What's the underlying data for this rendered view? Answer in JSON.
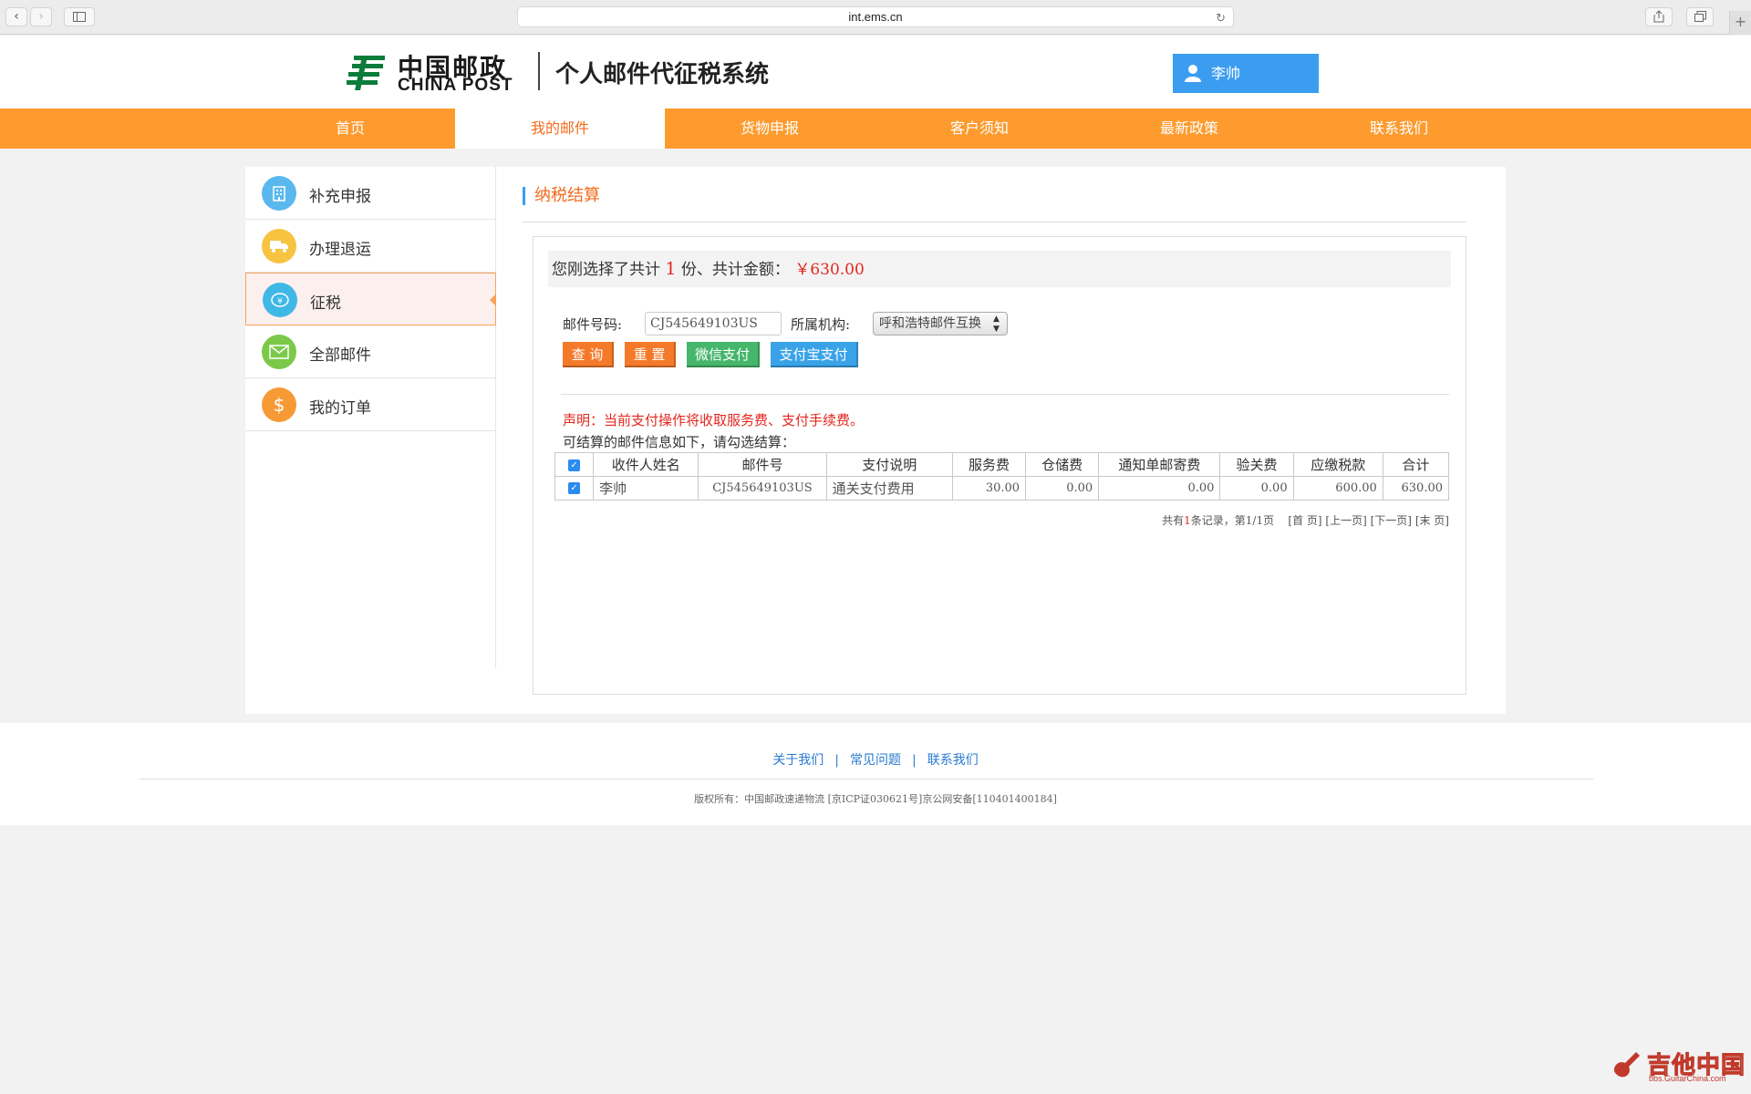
{
  "browser": {
    "url": "int.ems.cn",
    "plus": "+"
  },
  "header": {
    "logo_cn": "中国邮政",
    "logo_en": "CHINA POST",
    "system_title": "个人邮件代征税系统",
    "user_name": "李帅"
  },
  "nav": {
    "items": [
      "首页",
      "我的邮件",
      "货物申报",
      "客户须知",
      "最新政策",
      "联系我们"
    ],
    "active": "我的邮件"
  },
  "sidebar": {
    "items": [
      {
        "label": "补充申报",
        "icon": "building-icon",
        "color": "#5bb8ef"
      },
      {
        "label": "办理退运",
        "icon": "truck-icon",
        "color": "#f7c340"
      },
      {
        "label": "征税",
        "icon": "tax-icon",
        "color": "#3fb8e6"
      },
      {
        "label": "全部邮件",
        "icon": "mail-icon",
        "color": "#7cc94a"
      },
      {
        "label": "我的订单",
        "icon": "dollar-icon",
        "color": "#f69a35"
      }
    ],
    "active": "征税"
  },
  "content": {
    "section_title": "纳税结算",
    "summary_prefix": "您刚选择了共计",
    "summary_count": "1",
    "summary_mid": "份、共计金额：",
    "summary_amount": "￥630.00",
    "form": {
      "mail_no_label": "邮件号码:",
      "mail_no_value": "CJ545649103US",
      "org_label": "所属机构:",
      "org_value": "呼和浩特邮件互换",
      "query_btn": "查 询",
      "reset_btn": "重 置",
      "wechat_btn": "微信支付",
      "alipay_btn": "支付宝支付"
    },
    "notice": "声明：当前支付操作将收取服务费、支付手续费。",
    "hint": "可结算的邮件信息如下，请勾选结算：",
    "table": {
      "headers": [
        "收件人姓名",
        "邮件号",
        "支付说明",
        "服务费",
        "仓储费",
        "通知单邮寄费",
        "验关费",
        "应缴税款",
        "合计"
      ],
      "rows": [
        {
          "name": "李帅",
          "mail_no": "CJ545649103US",
          "desc": "通关支付费用",
          "service": "30.00",
          "storage": "0.00",
          "notice_fee": "0.00",
          "inspect": "0.00",
          "tax": "600.00",
          "total": "630.00"
        }
      ]
    },
    "pager": {
      "prefix": "共有",
      "count": "1",
      "suffix": "条记录，第1/1页",
      "first": "[首 页]",
      "prev": "[上一页]",
      "next": "[下一页]",
      "last": "[末 页]"
    }
  },
  "footer": {
    "links": [
      "关于我们",
      "常见问题",
      "联系我们"
    ],
    "separator": "|",
    "copyright": "版权所有：中国邮政速递物流 [京ICP证030621号]京公网安备[110401400184]"
  },
  "watermark": {
    "text": "吉他中国",
    "sub": "bbs.GuitarChina.com"
  }
}
